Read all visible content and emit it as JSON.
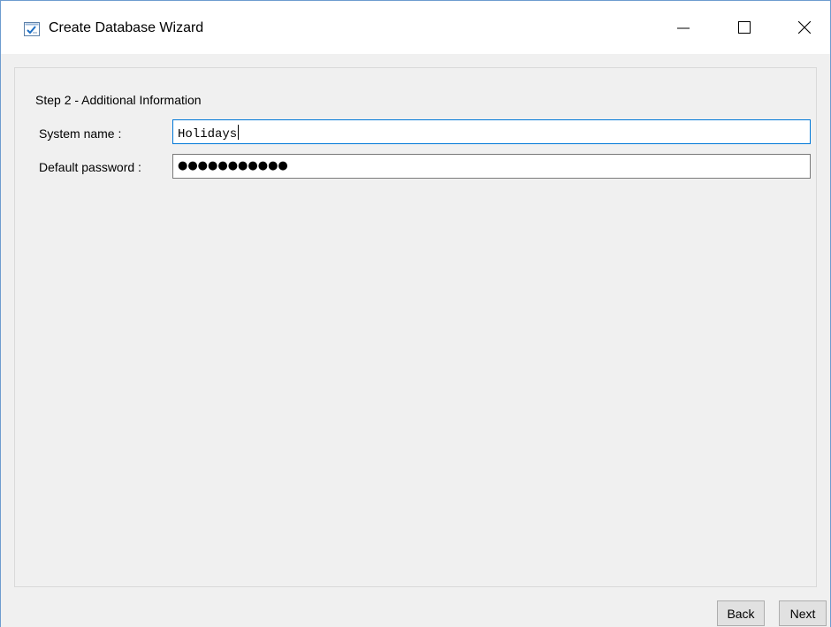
{
  "window": {
    "title": "Create Database Wizard",
    "icon": "wizard-checklist-icon",
    "accent_color": "#0078d7"
  },
  "title_controls": {
    "minimize_icon": "minimize-icon",
    "maximize_icon": "maximize-icon",
    "close_icon": "close-icon"
  },
  "step": {
    "title": "Step 2 - Additional Information"
  },
  "form": {
    "system_name": {
      "label": "System name :",
      "value": "Holidays"
    },
    "default_password": {
      "label": "Default password :",
      "value": "●●●●●●●●●●●"
    }
  },
  "buttons": {
    "back": "Back",
    "next": "Next"
  }
}
